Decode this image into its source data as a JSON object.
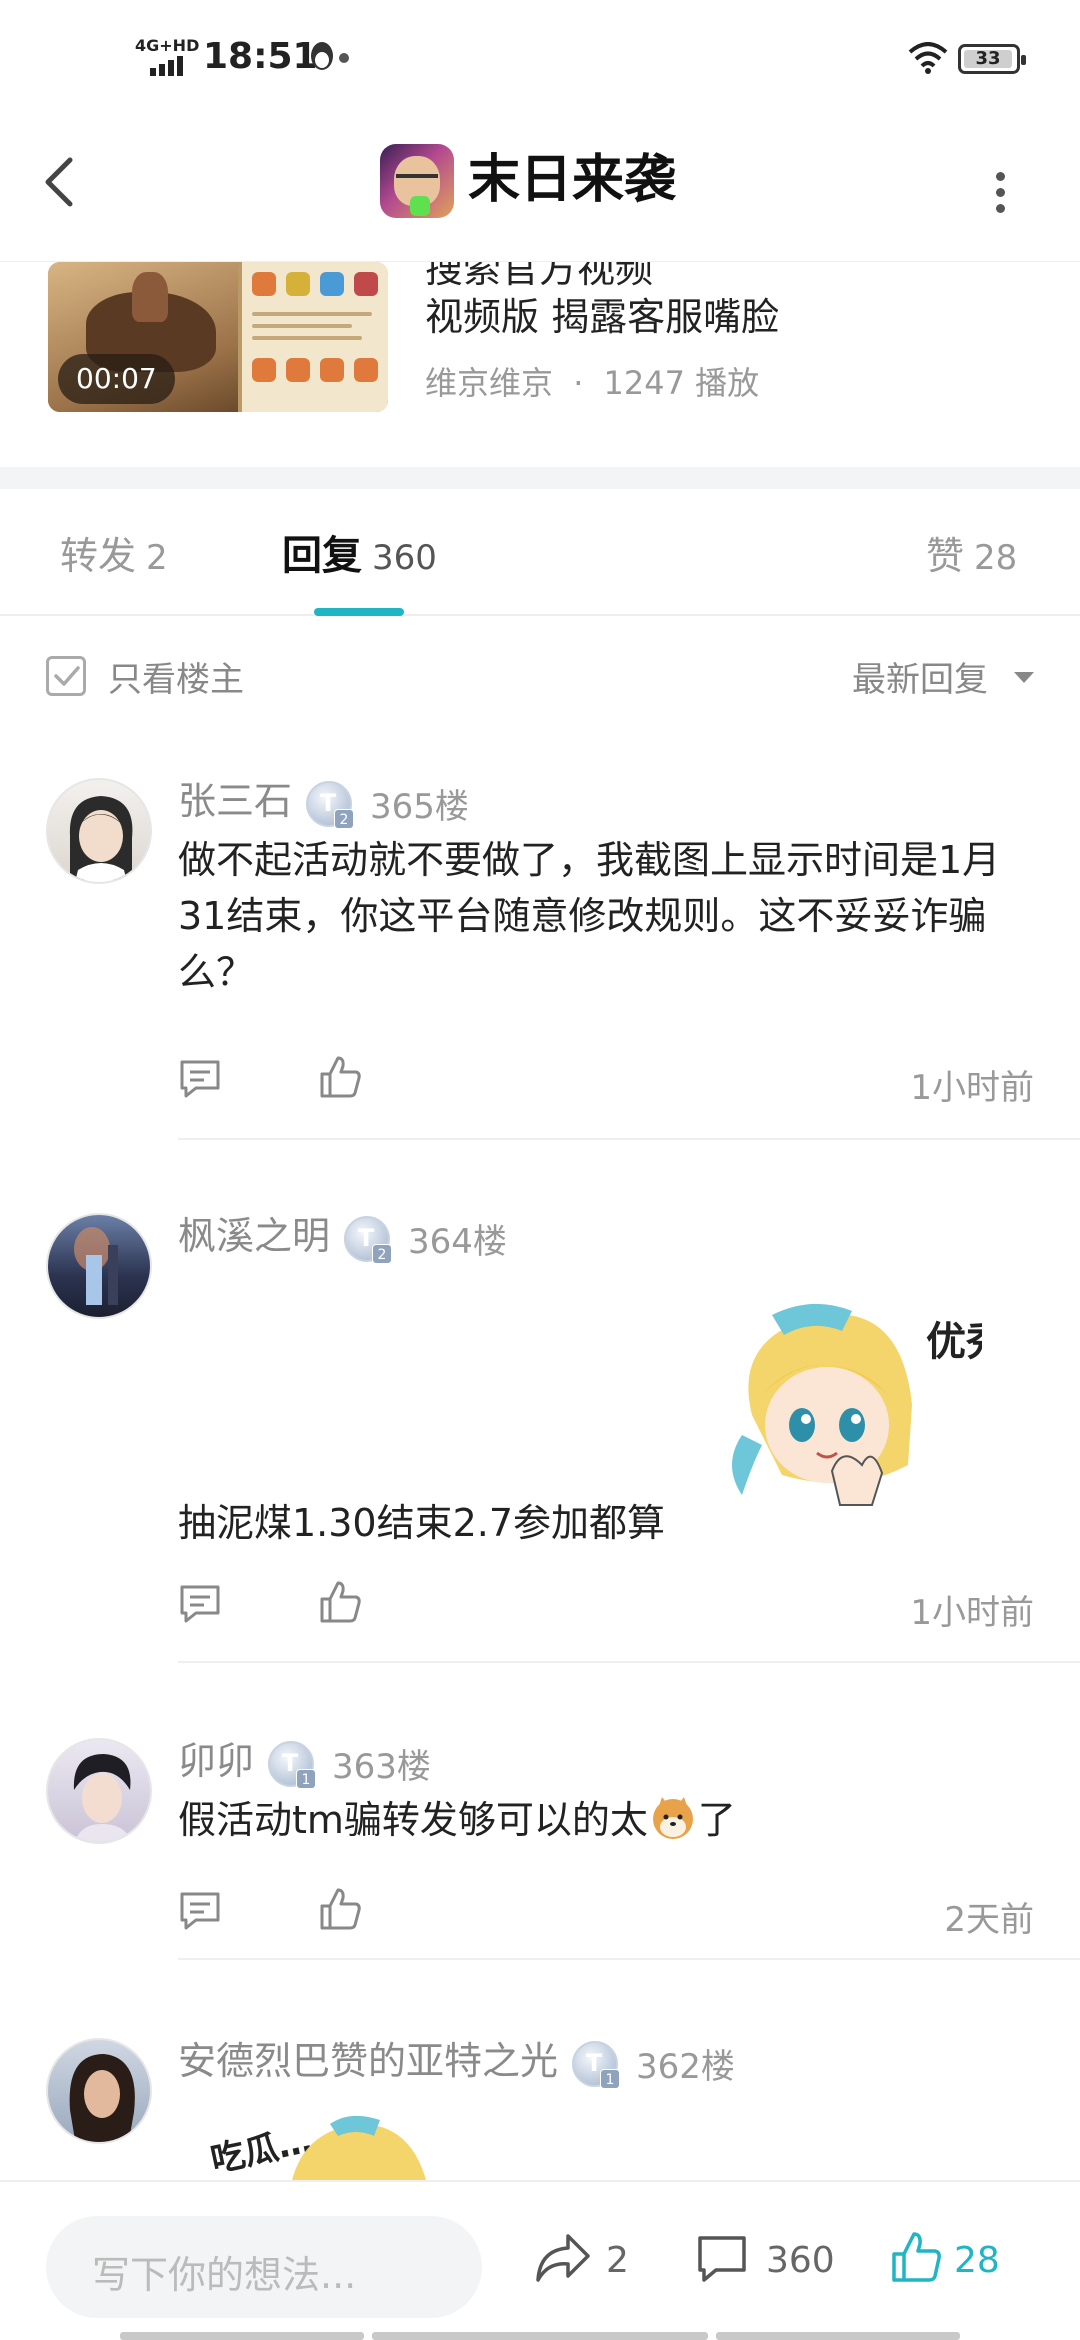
{
  "status_bar": {
    "network": "4G+HD",
    "time": "18:51",
    "battery": "33"
  },
  "header": {
    "title": "末日来袭"
  },
  "video": {
    "duration": "00:07",
    "title_line1": "搜索官方视频",
    "title_line2": "视频版 揭露客服嘴脸",
    "author": "维京维京",
    "plays": "1247 播放",
    "separator": "·"
  },
  "tabs": [
    {
      "label": "转发",
      "count": "2"
    },
    {
      "label": "回复",
      "count": "360",
      "active": true
    },
    {
      "label": "赞",
      "count": "28"
    }
  ],
  "filter": {
    "only_op": "只看楼主",
    "sort": "最新回复"
  },
  "comments": [
    {
      "user": "张三石",
      "level": "2",
      "floor": "365楼",
      "text": "做不起活动就不要做了，我截图上显示时间是1月31结束，你这平台随意修改规则。这不妥妥诈骗么？",
      "time": "1小时前"
    },
    {
      "user": "枫溪之明",
      "level": "2",
      "floor": "364楼",
      "sticker_text": "优秀",
      "text": "抽泥煤1.30结束2.7参加都算",
      "time": "1小时前"
    },
    {
      "user": "卯卯",
      "level": "1",
      "floor": "363楼",
      "text": "假活动tm骗转发够可以的太",
      "text_after": "了",
      "time": "2天前"
    },
    {
      "user": "安德烈巴赞的亚特之光",
      "level": "1",
      "floor": "362楼",
      "sticker_text": "吃瓜…"
    }
  ],
  "bottom_bar": {
    "placeholder": "写下你的想法...",
    "share_count": "2",
    "comment_count": "360",
    "like_count": "28"
  },
  "colors": {
    "accent": "#1fb5c3",
    "muted": "#999999",
    "text": "#222222"
  }
}
